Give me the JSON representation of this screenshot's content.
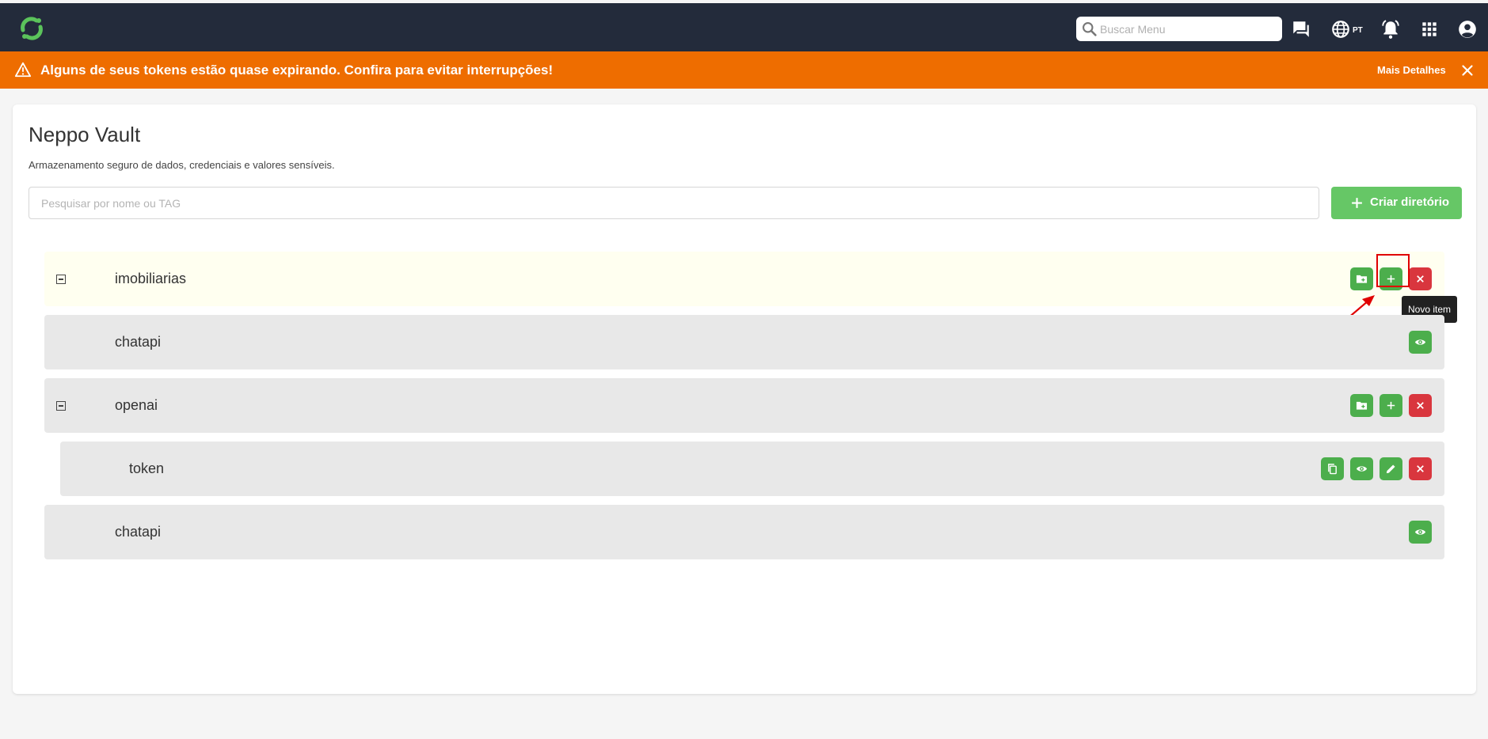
{
  "header": {
    "search_placeholder": "Buscar Menu",
    "language": "PT"
  },
  "banner": {
    "message": "Alguns de seus tokens estão quase expirando. Confira para evitar interrupções!",
    "details_label": "Mais Detalhes"
  },
  "page": {
    "title": "Neppo Vault",
    "subtitle": "Armazenamento seguro de dados, credenciais e valores sensíveis.",
    "filter_placeholder": "Pesquisar por nome ou TAG",
    "create_label": "Criar diretório"
  },
  "tree": [
    {
      "name": "imobiliarias",
      "kind": "directory",
      "state": "expanded"
    },
    {
      "name": "chatapi",
      "kind": "item"
    },
    {
      "name": "openai",
      "kind": "directory",
      "state": "expanded"
    },
    {
      "name": "token",
      "kind": "item",
      "actions": [
        "copy",
        "view",
        "edit",
        "delete"
      ]
    },
    {
      "name": "chatapi",
      "kind": "item"
    }
  ],
  "tooltip": "Novo item",
  "colors": {
    "topbar": "#232b3b",
    "banner": "#ee6d00",
    "green": "#4cae4c",
    "create_green": "#66c766",
    "red": "#d9363e",
    "selected_row": "#fffff0",
    "row": "#e8e8e8"
  }
}
